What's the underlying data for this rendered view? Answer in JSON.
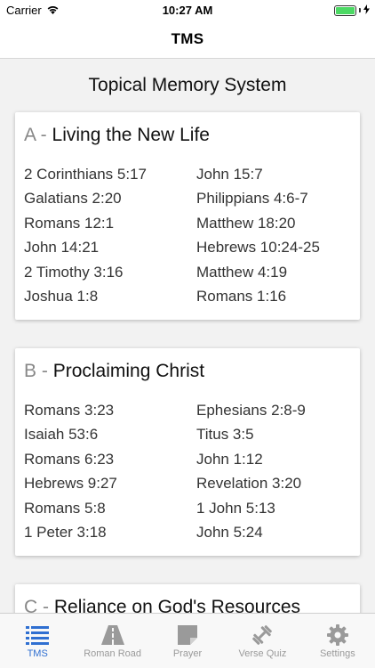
{
  "status_bar": {
    "carrier": "Carrier",
    "time": "10:27 AM"
  },
  "nav": {
    "title": "TMS"
  },
  "page": {
    "heading": "Topical Memory System"
  },
  "sections": [
    {
      "letter": "A -",
      "title": "Living the New Life",
      "verses": [
        "2 Corinthians 5:17",
        "John 15:7",
        "Galatians 2:20",
        "Philippians 4:6-7",
        "Romans 12:1",
        "Matthew 18:20",
        "John 14:21",
        "Hebrews 10:24-25",
        "2 Timothy 3:16",
        "Matthew 4:19",
        "Joshua 1:8",
        "Romans 1:16"
      ]
    },
    {
      "letter": "B -",
      "title": "Proclaiming Christ",
      "verses": [
        "Romans 3:23",
        "Ephesians 2:8-9",
        "Isaiah 53:6",
        "Titus 3:5",
        "Romans 6:23",
        "John 1:12",
        "Hebrews 9:27",
        "Revelation 3:20",
        "Romans 5:8",
        "1 John 5:13",
        "1 Peter 3:18",
        "John 5:24"
      ]
    },
    {
      "letter": "C -",
      "title": "Reliance on God's Resources",
      "verses": []
    }
  ],
  "tabs": [
    {
      "label": "TMS",
      "icon": "list-icon",
      "active": true
    },
    {
      "label": "Roman Road",
      "icon": "road-icon",
      "active": false
    },
    {
      "label": "Prayer",
      "icon": "note-icon",
      "active": false
    },
    {
      "label": "Verse Quiz",
      "icon": "dumbbell-icon",
      "active": false
    },
    {
      "label": "Settings",
      "icon": "gear-icon",
      "active": false
    }
  ],
  "colors": {
    "accent": "#2f6fd1",
    "inactive": "#9a9a9a",
    "battery": "#4cd964"
  }
}
